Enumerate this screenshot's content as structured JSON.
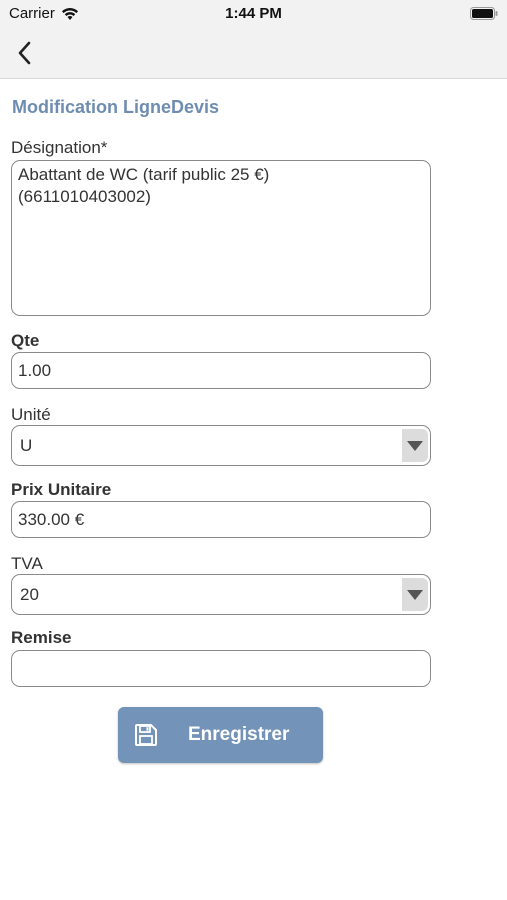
{
  "status_bar": {
    "carrier": "Carrier",
    "time": "1:44 PM"
  },
  "nav": {
    "back_icon": "chevron-left-icon"
  },
  "page": {
    "title": "Modification LigneDevis"
  },
  "form": {
    "designation": {
      "label": "Désignation*",
      "value_line1": "Abattant de WC (tarif public 25 €)",
      "value_line2": "(6611010403002)"
    },
    "qte": {
      "label": "Qte",
      "value": "1.00"
    },
    "unite": {
      "label": "Unité",
      "selected": "U"
    },
    "prix_unitaire": {
      "label": "Prix Unitaire",
      "value": "330.00 €"
    },
    "tva": {
      "label": "TVA",
      "selected": "20"
    },
    "remise": {
      "label": "Remise",
      "value": ""
    }
  },
  "actions": {
    "save_label": "Enregistrer",
    "save_icon": "floppy-disk-icon"
  },
  "colors": {
    "accent": "#6e8db0",
    "button": "#7394b8",
    "bar": "#f2f2f2"
  }
}
